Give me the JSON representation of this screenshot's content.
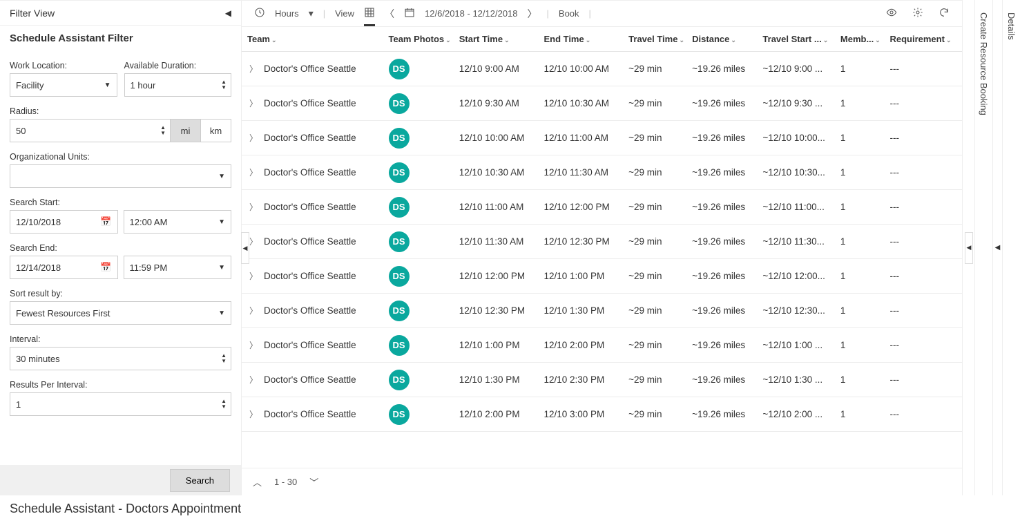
{
  "header": {
    "filter_view": "Filter View",
    "filter_sub": "Schedule Assistant Filter"
  },
  "filters": {
    "work_location_label": "Work Location:",
    "work_location_value": "Facility",
    "avail_dur_label": "Available Duration:",
    "avail_dur_value": "1 hour",
    "radius_label": "Radius:",
    "radius_value": "50",
    "unit_mi": "mi",
    "unit_km": "km",
    "org_units_label": "Organizational Units:",
    "org_units_value": "",
    "search_start_label": "Search Start:",
    "search_start_date": "12/10/2018",
    "search_start_time": "12:00 AM",
    "search_end_label": "Search End:",
    "search_end_date": "12/14/2018",
    "search_end_time": "11:59 PM",
    "sort_label": "Sort result by:",
    "sort_value": "Fewest Resources First",
    "interval_label": "Interval:",
    "interval_value": "30 minutes",
    "rpi_label": "Results Per Interval:",
    "rpi_value": "1",
    "search_btn": "Search"
  },
  "toolbar": {
    "hours": "Hours",
    "view": "View",
    "date_range": "12/6/2018 - 12/12/2018",
    "book": "Book"
  },
  "columns": {
    "team": "Team",
    "photos": "Team Photos",
    "start": "Start Time",
    "end": "End Time",
    "travel": "Travel Time",
    "distance": "Distance",
    "travel_start": "Travel Start ...",
    "members": "Memb...",
    "requirement": "Requirement"
  },
  "avatar_initials": "DS",
  "rows": [
    {
      "team": "Doctor's Office Seattle",
      "start": "12/10 9:00 AM",
      "end": "12/10 10:00 AM",
      "travel": "~29 min",
      "dist": "~19.26 miles",
      "tstart": "~12/10 9:00 ...",
      "members": "1",
      "req": "---"
    },
    {
      "team": "Doctor's Office Seattle",
      "start": "12/10 9:30 AM",
      "end": "12/10 10:30 AM",
      "travel": "~29 min",
      "dist": "~19.26 miles",
      "tstart": "~12/10 9:30 ...",
      "members": "1",
      "req": "---"
    },
    {
      "team": "Doctor's Office Seattle",
      "start": "12/10 10:00 AM",
      "end": "12/10 11:00 AM",
      "travel": "~29 min",
      "dist": "~19.26 miles",
      "tstart": "~12/10 10:00...",
      "members": "1",
      "req": "---"
    },
    {
      "team": "Doctor's Office Seattle",
      "start": "12/10 10:30 AM",
      "end": "12/10 11:30 AM",
      "travel": "~29 min",
      "dist": "~19.26 miles",
      "tstart": "~12/10 10:30...",
      "members": "1",
      "req": "---"
    },
    {
      "team": "Doctor's Office Seattle",
      "start": "12/10 11:00 AM",
      "end": "12/10 12:00 PM",
      "travel": "~29 min",
      "dist": "~19.26 miles",
      "tstart": "~12/10 11:00...",
      "members": "1",
      "req": "---"
    },
    {
      "team": "Doctor's Office Seattle",
      "start": "12/10 11:30 AM",
      "end": "12/10 12:30 PM",
      "travel": "~29 min",
      "dist": "~19.26 miles",
      "tstart": "~12/10 11:30...",
      "members": "1",
      "req": "---"
    },
    {
      "team": "Doctor's Office Seattle",
      "start": "12/10 12:00 PM",
      "end": "12/10 1:00 PM",
      "travel": "~29 min",
      "dist": "~19.26 miles",
      "tstart": "~12/10 12:00...",
      "members": "1",
      "req": "---"
    },
    {
      "team": "Doctor's Office Seattle",
      "start": "12/10 12:30 PM",
      "end": "12/10 1:30 PM",
      "travel": "~29 min",
      "dist": "~19.26 miles",
      "tstart": "~12/10 12:30...",
      "members": "1",
      "req": "---"
    },
    {
      "team": "Doctor's Office Seattle",
      "start": "12/10 1:00 PM",
      "end": "12/10 2:00 PM",
      "travel": "~29 min",
      "dist": "~19.26 miles",
      "tstart": "~12/10 1:00 ...",
      "members": "1",
      "req": "---"
    },
    {
      "team": "Doctor's Office Seattle",
      "start": "12/10 1:30 PM",
      "end": "12/10 2:30 PM",
      "travel": "~29 min",
      "dist": "~19.26 miles",
      "tstart": "~12/10 1:30 ...",
      "members": "1",
      "req": "---"
    },
    {
      "team": "Doctor's Office Seattle",
      "start": "12/10 2:00 PM",
      "end": "12/10 3:00 PM",
      "travel": "~29 min",
      "dist": "~19.26 miles",
      "tstart": "~12/10 2:00 ...",
      "members": "1",
      "req": "---"
    }
  ],
  "pager": {
    "range": "1 - 30"
  },
  "right": {
    "create_booking": "Create Resource Booking",
    "details": "Details"
  },
  "footer": {
    "title": "Schedule Assistant - Doctors Appointment"
  }
}
